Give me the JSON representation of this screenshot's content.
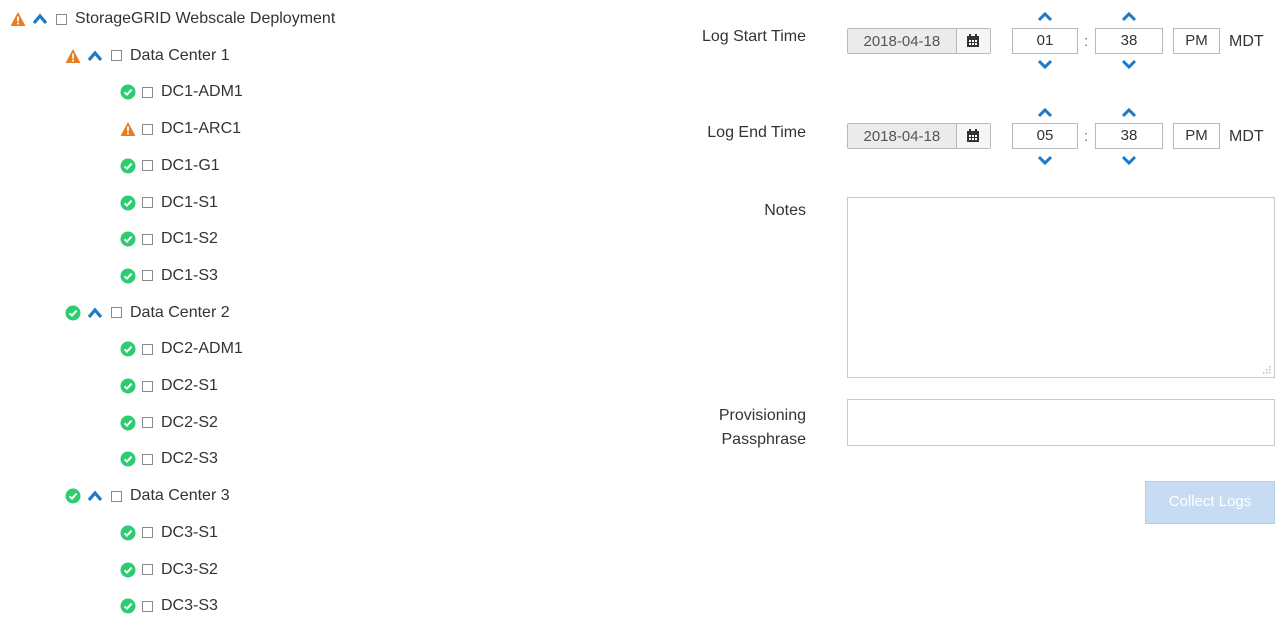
{
  "colors": {
    "ok": "#2ecc71",
    "warning": "#e67e22",
    "chevron": "#1f79c4",
    "button_disabled_bg": "#c7dcf3"
  },
  "tree": {
    "root": {
      "label": "StorageGRID Webscale Deployment",
      "status": "warning",
      "expanded": true
    },
    "sites": [
      {
        "label": "Data Center 1",
        "status": "warning",
        "expanded": true,
        "nodes": [
          {
            "label": "DC1-ADM1",
            "status": "ok"
          },
          {
            "label": "DC1-ARC1",
            "status": "warning"
          },
          {
            "label": "DC1-G1",
            "status": "ok"
          },
          {
            "label": "DC1-S1",
            "status": "ok"
          },
          {
            "label": "DC1-S2",
            "status": "ok"
          },
          {
            "label": "DC1-S3",
            "status": "ok"
          }
        ]
      },
      {
        "label": "Data Center 2",
        "status": "ok",
        "expanded": true,
        "nodes": [
          {
            "label": "DC2-ADM1",
            "status": "ok"
          },
          {
            "label": "DC2-S1",
            "status": "ok"
          },
          {
            "label": "DC2-S2",
            "status": "ok"
          },
          {
            "label": "DC2-S3",
            "status": "ok"
          }
        ]
      },
      {
        "label": "Data Center 3",
        "status": "ok",
        "expanded": true,
        "nodes": [
          {
            "label": "DC3-S1",
            "status": "ok"
          },
          {
            "label": "DC3-S2",
            "status": "ok"
          },
          {
            "label": "DC3-S3",
            "status": "ok"
          }
        ]
      }
    ]
  },
  "form": {
    "start": {
      "label": "Log Start Time",
      "date": "2018-04-18",
      "hour": "01",
      "minute": "38",
      "ampm": "PM",
      "tz": "MDT"
    },
    "end": {
      "label": "Log End Time",
      "date": "2018-04-18",
      "hour": "05",
      "minute": "38",
      "ampm": "PM",
      "tz": "MDT"
    },
    "separator": ":",
    "notes": {
      "label": "Notes",
      "value": ""
    },
    "passphrase": {
      "label_line1": "Provisioning",
      "label_line2": "Passphrase",
      "value": ""
    },
    "submit_label": "Collect Logs"
  },
  "icons": {
    "ok": "check-circle-icon",
    "warning": "warning-triangle-icon",
    "expand": "chevron-up-icon",
    "calendar": "calendar-icon",
    "increment": "chevron-up-icon",
    "decrement": "chevron-down-icon"
  }
}
